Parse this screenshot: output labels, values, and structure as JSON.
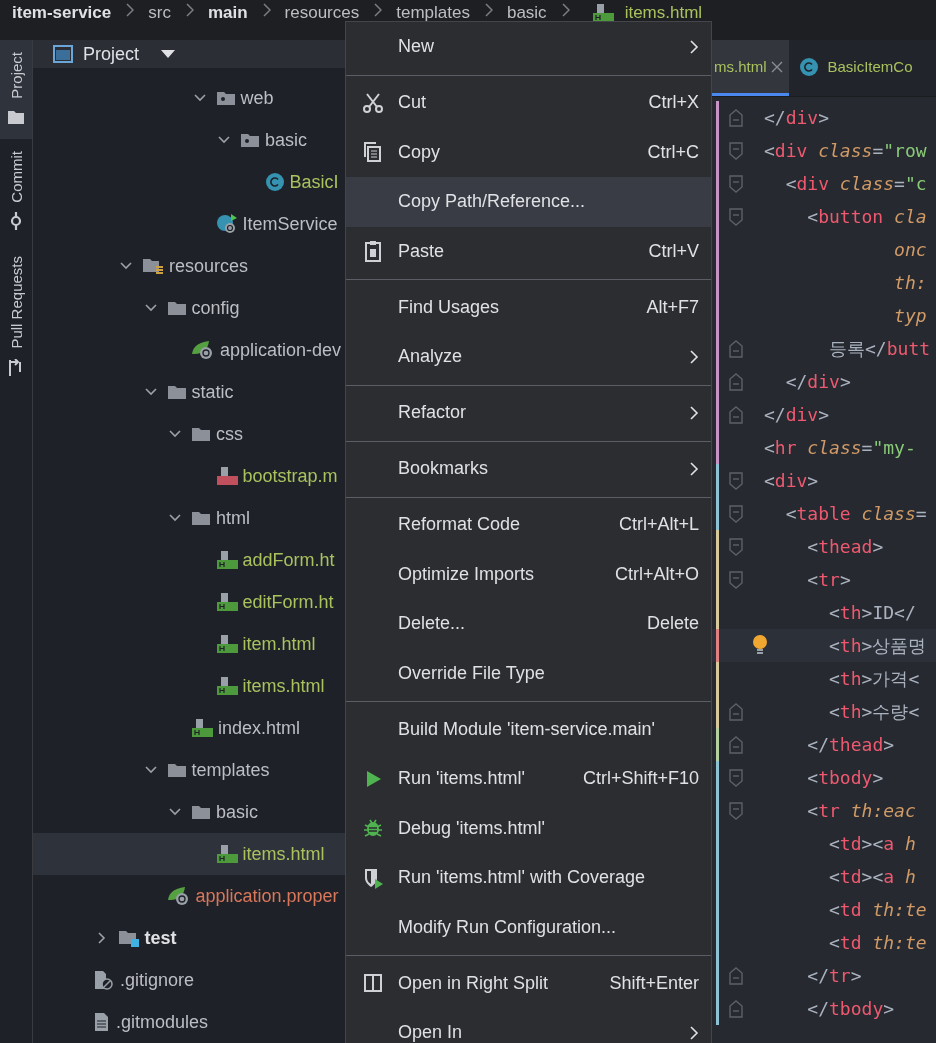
{
  "breadcrumb": [
    {
      "label": "item-service",
      "bold": true,
      "color": "#dfe1e5"
    },
    {
      "label": "src",
      "bold": false,
      "color": "#bcbec4"
    },
    {
      "label": "main",
      "bold": true,
      "color": "#dfe1e5"
    },
    {
      "label": "resources",
      "bold": false,
      "color": "#bcbec4"
    },
    {
      "label": "templates",
      "bold": false,
      "color": "#bcbec4"
    },
    {
      "label": "basic",
      "bold": false,
      "color": "#bcbec4"
    },
    {
      "label": "items.html",
      "bold": false,
      "color": "#a9c25e",
      "kind": "html"
    }
  ],
  "tool_strip": [
    {
      "label": "Project",
      "kind": "folder",
      "selected": true
    },
    {
      "label": "Commit",
      "kind": "commit",
      "selected": false
    },
    {
      "label": "Pull Requests",
      "kind": "pull",
      "selected": false
    }
  ],
  "project_panel": {
    "title": "Project",
    "tree": [
      {
        "children": [
          {
            "children": [
              {
                "children": [
                  {
                    "children": [
                      {
                        "children": [
                          {
                            "label": "web",
                            "kind": "package",
                            "expanded": true,
                            "selected": false,
                            "color": "#bcbec4",
                            "children": [
                              {
                                "label": "basic",
                                "kind": "package",
                                "expanded": true,
                                "selected": false,
                                "color": "#bcbec4",
                                "children": [
                                  {
                                    "label": "BasicI",
                                    "kind": "class",
                                    "selected": false,
                                    "color": "#a9c25e"
                                  }
                                ]
                              }
                            ]
                          },
                          {
                            "label": "ItemService",
                            "kind": "spring-class",
                            "selected": false,
                            "color": "#bcbec4"
                          }
                        ]
                      }
                    ]
                  }
                ]
              },
              {
                "label": "resources",
                "kind": "resources",
                "expanded": true,
                "selected": false,
                "color": "#bcbec4",
                "children": [
                  {
                    "label": "config",
                    "kind": "folder",
                    "expanded": true,
                    "selected": false,
                    "color": "#bcbec4",
                    "children": [
                      {
                        "label": "application-dev",
                        "kind": "spring",
                        "selected": false,
                        "color": "#bcbec4"
                      }
                    ]
                  },
                  {
                    "label": "static",
                    "kind": "folder",
                    "expanded": true,
                    "selected": false,
                    "color": "#bcbec4",
                    "children": [
                      {
                        "label": "css",
                        "kind": "folder",
                        "expanded": true,
                        "selected": false,
                        "color": "#bcbec4",
                        "children": [
                          {
                            "label": "bootstrap.m",
                            "kind": "css",
                            "selected": false,
                            "color": "#a9c25e"
                          }
                        ]
                      },
                      {
                        "label": "html",
                        "kind": "folder",
                        "expanded": true,
                        "selected": false,
                        "color": "#bcbec4",
                        "children": [
                          {
                            "label": "addForm.ht",
                            "kind": "html",
                            "selected": false,
                            "color": "#a9c25e"
                          },
                          {
                            "label": "editForm.ht",
                            "kind": "html",
                            "selected": false,
                            "color": "#a9c25e"
                          },
                          {
                            "label": "item.html",
                            "kind": "html",
                            "selected": false,
                            "color": "#a9c25e"
                          },
                          {
                            "label": "items.html",
                            "kind": "html",
                            "selected": false,
                            "color": "#a9c25e"
                          }
                        ]
                      },
                      {
                        "label": "index.html",
                        "kind": "html",
                        "selected": false,
                        "color": "#bcbec4"
                      }
                    ]
                  },
                  {
                    "label": "templates",
                    "kind": "folder",
                    "expanded": true,
                    "selected": false,
                    "color": "#bcbec4",
                    "children": [
                      {
                        "label": "basic",
                        "kind": "folder",
                        "expanded": true,
                        "selected": false,
                        "color": "#bcbec4",
                        "children": [
                          {
                            "label": "items.html",
                            "kind": "html",
                            "selected": true,
                            "color": "#a9c25e"
                          }
                        ]
                      }
                    ]
                  },
                  {
                    "label": "application.proper",
                    "kind": "spring",
                    "selected": false,
                    "color": "#d9775b"
                  }
                ]
              }
            ]
          },
          {
            "label": "test",
            "kind": "test-folder",
            "expanded": false,
            "selected": false,
            "color": "#dfe1e5",
            "bold": true
          }
        ]
      },
      {
        "label": ".gitignore",
        "kind": "ignore",
        "selected": false,
        "color": "#bcbec4"
      },
      {
        "label": ".gitmodules",
        "kind": "text",
        "selected": false,
        "color": "#bcbec4"
      }
    ]
  },
  "editor": {
    "tabs": [
      {
        "label": "ms.html",
        "kind": "html",
        "selected": true,
        "closable": true
      },
      {
        "label": "BasicItemCo",
        "kind": "class",
        "selected": false,
        "closable": false
      }
    ],
    "lines": [
      {
        "kind": "fold-end",
        "color": "#c594c5",
        "tokens": [
          {
            "kind": "punct",
            "text": "</"
          },
          {
            "kind": "tag",
            "text": "div"
          },
          {
            "kind": "punct",
            "text": ">"
          }
        ]
      },
      {
        "kind": "fold-start",
        "color": "#c594c5",
        "tokens": [
          {
            "kind": "punct",
            "text": "<"
          },
          {
            "kind": "tag",
            "text": "div"
          },
          {
            "kind": "attr",
            "text": " class"
          },
          {
            "kind": "punct",
            "text": "="
          },
          {
            "kind": "string",
            "text": "\"row"
          }
        ]
      },
      {
        "kind": "fold-start",
        "color": "#c594c5",
        "tokens": [
          {
            "kind": "punct",
            "text": "  <"
          },
          {
            "kind": "tag",
            "text": "div"
          },
          {
            "kind": "attr",
            "text": " class"
          },
          {
            "kind": "punct",
            "text": "="
          },
          {
            "kind": "string",
            "text": "\"c"
          }
        ]
      },
      {
        "kind": "fold-start",
        "color": "#c594c5",
        "tokens": [
          {
            "kind": "punct",
            "text": "    <"
          },
          {
            "kind": "tag",
            "text": "button"
          },
          {
            "kind": "attr",
            "text": " cla"
          }
        ]
      },
      {
        "kind": "plain",
        "color": "#c594c5",
        "tokens": [
          {
            "kind": "attr",
            "text": "            onc"
          }
        ]
      },
      {
        "kind": "plain",
        "color": "#c594c5",
        "tokens": [
          {
            "kind": "attr",
            "text": "            th:"
          }
        ]
      },
      {
        "kind": "plain",
        "color": "#c594c5",
        "tokens": [
          {
            "kind": "attr",
            "text": "            typ"
          }
        ]
      },
      {
        "kind": "fold-end",
        "color": "#c594c5",
        "tokens": [
          {
            "kind": "text",
            "text": "      등록"
          },
          {
            "kind": "punct",
            "text": "</"
          },
          {
            "kind": "tag",
            "text": "butt"
          }
        ]
      },
      {
        "kind": "fold-end",
        "color": "#c594c5",
        "tokens": [
          {
            "kind": "punct",
            "text": "  </"
          },
          {
            "kind": "tag",
            "text": "div"
          },
          {
            "kind": "punct",
            "text": ">"
          }
        ]
      },
      {
        "kind": "fold-end",
        "color": "#c594c5",
        "tokens": [
          {
            "kind": "punct",
            "text": "</"
          },
          {
            "kind": "tag",
            "text": "div"
          },
          {
            "kind": "punct",
            "text": ">"
          }
        ]
      },
      {
        "kind": "plain",
        "color": "#c594c5",
        "tokens": [
          {
            "kind": "punct",
            "text": "<"
          },
          {
            "kind": "tag",
            "text": "hr"
          },
          {
            "kind": "attr",
            "text": " class"
          },
          {
            "kind": "punct",
            "text": "="
          },
          {
            "kind": "string",
            "text": "\"my-"
          }
        ]
      },
      {
        "kind": "fold-start",
        "color": "#8fc1d4",
        "tokens": [
          {
            "kind": "punct",
            "text": "<"
          },
          {
            "kind": "tag",
            "text": "div"
          },
          {
            "kind": "punct",
            "text": ">"
          }
        ]
      },
      {
        "kind": "fold-start",
        "color": "#8fc1d4",
        "tokens": [
          {
            "kind": "punct",
            "text": "  <"
          },
          {
            "kind": "tag",
            "text": "table"
          },
          {
            "kind": "attr",
            "text": " class"
          },
          {
            "kind": "punct",
            "text": "="
          }
        ]
      },
      {
        "kind": "fold-start",
        "color": "#d8c99b",
        "tokens": [
          {
            "kind": "punct",
            "text": "    <"
          },
          {
            "kind": "tag",
            "text": "thead"
          },
          {
            "kind": "punct",
            "text": ">"
          }
        ]
      },
      {
        "kind": "fold-start",
        "color": "#d8c99b",
        "tokens": [
          {
            "kind": "punct",
            "text": "    <"
          },
          {
            "kind": "tag",
            "text": "tr"
          },
          {
            "kind": "punct",
            "text": ">"
          }
        ]
      },
      {
        "kind": "plain",
        "color": "#d8c99b",
        "tokens": [
          {
            "kind": "punct",
            "text": "      <"
          },
          {
            "kind": "tag",
            "text": "th"
          },
          {
            "kind": "punct",
            "text": ">"
          },
          {
            "kind": "text",
            "text": "ID"
          },
          {
            "kind": "punct",
            "text": "</"
          }
        ]
      },
      {
        "kind": "plain",
        "current": true,
        "color": "#e08080",
        "tokens": [
          {
            "kind": "punct",
            "text": "      <"
          },
          {
            "kind": "tag",
            "text": "th"
          },
          {
            "kind": "punct",
            "text": ">"
          },
          {
            "kind": "text",
            "text": "상품명"
          }
        ]
      },
      {
        "kind": "plain",
        "color": "#d8c99b",
        "tokens": [
          {
            "kind": "punct",
            "text": "      <"
          },
          {
            "kind": "tag",
            "text": "th"
          },
          {
            "kind": "punct",
            "text": ">"
          },
          {
            "kind": "text",
            "text": "가격"
          },
          {
            "kind": "punct",
            "text": "<"
          }
        ]
      },
      {
        "kind": "fold-end",
        "color": "#d8c99b",
        "tokens": [
          {
            "kind": "punct",
            "text": "      <"
          },
          {
            "kind": "tag",
            "text": "th"
          },
          {
            "kind": "punct",
            "text": ">"
          },
          {
            "kind": "text",
            "text": "수량"
          },
          {
            "kind": "punct",
            "text": "<"
          }
        ]
      },
      {
        "kind": "fold-end",
        "color": "#b5cfa0",
        "tokens": [
          {
            "kind": "punct",
            "text": "    </"
          },
          {
            "kind": "tag",
            "text": "thead"
          },
          {
            "kind": "punct",
            "text": ">"
          }
        ]
      },
      {
        "kind": "fold-start",
        "color": "#8fc1d4",
        "tokens": [
          {
            "kind": "punct",
            "text": "    <"
          },
          {
            "kind": "tag",
            "text": "tbody"
          },
          {
            "kind": "punct",
            "text": ">"
          }
        ]
      },
      {
        "kind": "fold-start",
        "color": "#8fc1d4",
        "tokens": [
          {
            "kind": "punct",
            "text": "    <"
          },
          {
            "kind": "tag",
            "text": "tr"
          },
          {
            "kind": "attr",
            "text": " th:eac"
          }
        ]
      },
      {
        "kind": "plain",
        "color": "#8fc1d4",
        "tokens": [
          {
            "kind": "punct",
            "text": "      <"
          },
          {
            "kind": "tag",
            "text": "td"
          },
          {
            "kind": "punct",
            "text": "><"
          },
          {
            "kind": "tag",
            "text": "a"
          },
          {
            "kind": "attr",
            "text": " h"
          }
        ]
      },
      {
        "kind": "plain",
        "color": "#8fc1d4",
        "tokens": [
          {
            "kind": "punct",
            "text": "      <"
          },
          {
            "kind": "tag",
            "text": "td"
          },
          {
            "kind": "punct",
            "text": "><"
          },
          {
            "kind": "tag",
            "text": "a"
          },
          {
            "kind": "attr",
            "text": " h"
          }
        ]
      },
      {
        "kind": "plain",
        "color": "#8fc1d4",
        "tokens": [
          {
            "kind": "punct",
            "text": "      <"
          },
          {
            "kind": "tag",
            "text": "td"
          },
          {
            "kind": "attr",
            "text": " th:te"
          }
        ]
      },
      {
        "kind": "plain",
        "color": "#8fc1d4",
        "tokens": [
          {
            "kind": "punct",
            "text": "      <"
          },
          {
            "kind": "tag",
            "text": "td"
          },
          {
            "kind": "attr",
            "text": " th:te"
          }
        ]
      },
      {
        "kind": "fold-end",
        "color": "#8fc1d4",
        "tokens": [
          {
            "kind": "punct",
            "text": "    </"
          },
          {
            "kind": "tag",
            "text": "tr"
          },
          {
            "kind": "punct",
            "text": ">"
          }
        ]
      },
      {
        "kind": "fold-end",
        "color": "#8fc1d4",
        "tokens": [
          {
            "kind": "punct",
            "text": "    </"
          },
          {
            "kind": "tag",
            "text": "tbody"
          },
          {
            "kind": "punct",
            "text": ">"
          }
        ]
      }
    ]
  },
  "context_menu": [
    {
      "kind": "plain",
      "label": "New",
      "submenu": true,
      "selected": false
    },
    {
      "kind": "separator"
    },
    {
      "kind": "cut",
      "label": "Cut",
      "shortcut": "Ctrl+X",
      "submenu": false,
      "selected": false
    },
    {
      "kind": "copy",
      "label": "Copy",
      "shortcut": "Ctrl+C",
      "submenu": false,
      "selected": false
    },
    {
      "kind": "plain",
      "label": "Copy Path/Reference...",
      "submenu": false,
      "selected": true
    },
    {
      "kind": "paste",
      "label": "Paste",
      "shortcut": "Ctrl+V",
      "submenu": false,
      "selected": false
    },
    {
      "kind": "separator"
    },
    {
      "kind": "plain",
      "label": "Find Usages",
      "shortcut": "Alt+F7",
      "submenu": false,
      "selected": false
    },
    {
      "kind": "plain",
      "label": "Analyze",
      "submenu": true,
      "selected": false
    },
    {
      "kind": "separator"
    },
    {
      "kind": "plain",
      "label": "Refactor",
      "submenu": true,
      "selected": false
    },
    {
      "kind": "separator"
    },
    {
      "kind": "plain",
      "label": "Bookmarks",
      "submenu": true,
      "selected": false
    },
    {
      "kind": "separator"
    },
    {
      "kind": "plain",
      "label": "Reformat Code",
      "shortcut": "Ctrl+Alt+L",
      "submenu": false,
      "selected": false
    },
    {
      "kind": "plain",
      "label": "Optimize Imports",
      "shortcut": "Ctrl+Alt+O",
      "submenu": false,
      "selected": false
    },
    {
      "kind": "plain",
      "label": "Delete...",
      "shortcut": "Delete",
      "submenu": false,
      "selected": false
    },
    {
      "kind": "plain",
      "label": "Override File Type",
      "submenu": false,
      "selected": false
    },
    {
      "kind": "separator"
    },
    {
      "kind": "plain",
      "label": "Build Module 'item-service.main'",
      "submenu": false,
      "selected": false
    },
    {
      "kind": "run",
      "label": "Run 'items.html'",
      "shortcut": "Ctrl+Shift+F10",
      "submenu": false,
      "selected": false
    },
    {
      "kind": "debug",
      "label": "Debug 'items.html'",
      "submenu": false,
      "selected": false
    },
    {
      "kind": "coverage",
      "label": "Run 'items.html' with Coverage",
      "submenu": false,
      "selected": false
    },
    {
      "kind": "plain",
      "label": "Modify Run Configuration...",
      "submenu": false,
      "selected": false
    },
    {
      "kind": "separator"
    },
    {
      "kind": "split",
      "label": "Open in Right Split",
      "shortcut": "Shift+Enter",
      "submenu": false,
      "selected": false
    },
    {
      "kind": "plain",
      "label": "Open In",
      "submenu": true,
      "selected": false
    }
  ]
}
